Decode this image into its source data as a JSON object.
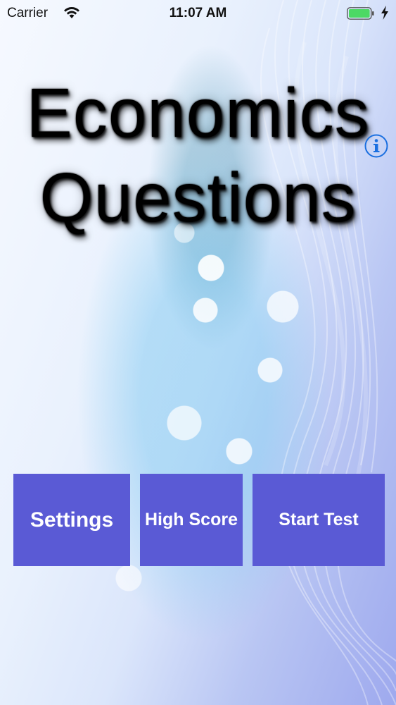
{
  "status_bar": {
    "carrier": "Carrier",
    "time": "11:07 AM",
    "battery_color": "#4cd964"
  },
  "title": {
    "line1": "Economics",
    "line2": "Questions"
  },
  "buttons": {
    "settings": "Settings",
    "high_score": "High Score",
    "start_test": "Start Test",
    "color": "#5a5ad5"
  },
  "icons": {
    "info": "info-icon",
    "wifi": "wifi-icon",
    "battery": "battery-icon",
    "charging": "charging-bolt-icon"
  },
  "accent_color": "#1a6fe0"
}
